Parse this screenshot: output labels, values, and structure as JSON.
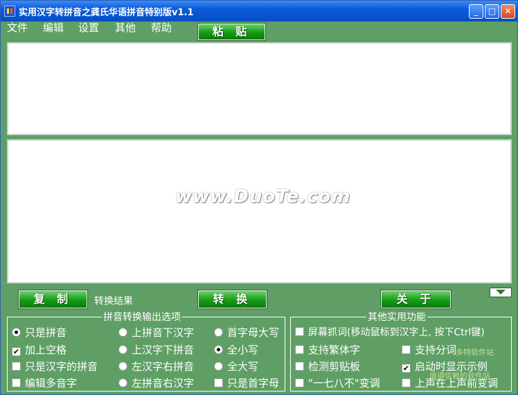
{
  "window": {
    "title": "实用汉字转拼音之龚氏华语拼音特别版v1.1",
    "controls": {
      "minimize": "_",
      "maximize": "□",
      "close": "✕"
    }
  },
  "menu": [
    "文件",
    "编辑",
    "设置",
    "其他",
    "帮助"
  ],
  "buttons": {
    "paste": "粘 贴",
    "copy": "复 制",
    "convert": "转 换",
    "about": "关 于"
  },
  "result_label": "转换结果",
  "watermark": "www.DuoTe.com",
  "output_options": {
    "title": "拼音转换输出选项",
    "col1": [
      {
        "label": "只是拼音",
        "type": "radio",
        "selected": true
      },
      {
        "label": "加上空格",
        "type": "checkbox",
        "checked": true
      },
      {
        "label": "只是汉字的拼音",
        "type": "checkbox",
        "checked": false
      },
      {
        "label": "编辑多音字",
        "type": "checkbox",
        "checked": false
      }
    ],
    "col2": [
      {
        "label": "上拼音下汉字",
        "type": "radio",
        "selected": false
      },
      {
        "label": "上汉字下拼音",
        "type": "radio",
        "selected": false
      },
      {
        "label": "左汉字右拼音",
        "type": "radio",
        "selected": false
      },
      {
        "label": "左拼音右汉字",
        "type": "radio",
        "selected": false
      }
    ],
    "col3": [
      {
        "label": "首字母大写",
        "type": "radio",
        "selected": false
      },
      {
        "label": "全小写",
        "type": "radio",
        "selected": true
      },
      {
        "label": "全大写",
        "type": "radio",
        "selected": false
      },
      {
        "label": "只是首字母",
        "type": "checkbox",
        "checked": false
      }
    ]
  },
  "utility": {
    "title": "其他实用功能",
    "screen_capture": "屏幕抓词(移动鼠标到汉字上, 按下Ctrl键)",
    "traditional": "支持繁体字",
    "split_words": "支持分词",
    "clipboard": "检测剪贴板",
    "show_on_start": "启动时显示示例",
    "tone_yi": "\"一七八不\"变调",
    "tone_shang": "上声在上声前变调"
  },
  "watermark_corner": "多特软件站",
  "watermark_corner2": "值得信赖的软件站"
}
